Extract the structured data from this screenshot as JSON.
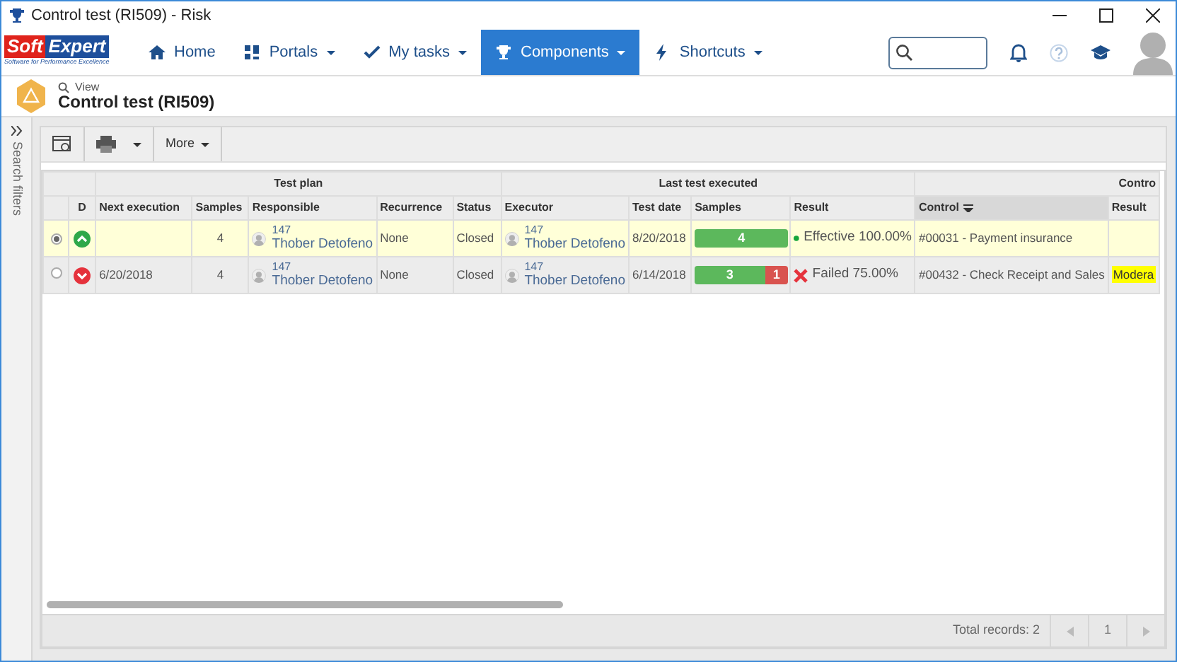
{
  "window": {
    "title": "Control test (RI509) - Risk"
  },
  "navbar": {
    "logo": {
      "word_1": "Soft",
      "word_2": "Expert",
      "tagline": "Software for Performance Excellence"
    },
    "items": [
      {
        "label": "Home",
        "kind": "home",
        "dropdown": false,
        "selected": false
      },
      {
        "label": "Portals",
        "kind": "portals",
        "dropdown": true,
        "selected": false
      },
      {
        "label": "My tasks",
        "kind": "tasks",
        "dropdown": true,
        "selected": false
      },
      {
        "label": "Components",
        "kind": "components",
        "dropdown": true,
        "selected": true
      },
      {
        "label": "Shortcuts",
        "kind": "shortcuts",
        "dropdown": true,
        "selected": false
      }
    ]
  },
  "header": {
    "mode": "View",
    "title": "Control test (RI509)"
  },
  "sidebar": {
    "label": "Search filters"
  },
  "toolbar": {
    "more": "More"
  },
  "table": {
    "groups": [
      {
        "columns": [
          {},
          {
            "label": "D"
          }
        ]
      },
      {
        "label": "Test plan",
        "columns": [
          {
            "label": "Next execution"
          },
          {
            "label": "Samples"
          },
          {
            "label": "Responsible"
          },
          {
            "label": "Recurrence"
          },
          {
            "label": "Status"
          }
        ]
      },
      {
        "label": "Last test executed",
        "columns": [
          {
            "label": "Executor"
          },
          {
            "label": "Test date"
          },
          {
            "label": "Samples"
          },
          {
            "label": "Result"
          }
        ]
      },
      {
        "label": "Contro",
        "columns": [
          {
            "label": "Control",
            "sorted": true
          },
          {
            "label": "Result",
            "sorted": false
          }
        ]
      }
    ],
    "rows": [
      {
        "selected": true,
        "kind": "up",
        "next_execution": "",
        "samples": "4",
        "responsible": {
          "code": "147",
          "name": "Thober Detofeno"
        },
        "recurrence": "None",
        "status": "Closed",
        "executor": {
          "code": "147",
          "name": "Thober Detofeno"
        },
        "test_date": "8/20/2018",
        "sample_bar": [
          {
            "kind": "pass",
            "label": "4",
            "level": 1
          }
        ],
        "result": {
          "kind": "effective",
          "text": "Effective 100.00%"
        },
        "control": "#00031 - Payment insurance"
      },
      {
        "selected": false,
        "kind": "down",
        "next_execution": "6/20/2018",
        "samples": "4",
        "responsible": {
          "code": "147",
          "name": "Thober Detofeno"
        },
        "recurrence": "None",
        "status": "Closed",
        "executor": {
          "code": "147",
          "name": "Thober Detofeno"
        },
        "test_date": "6/14/2018",
        "sample_bar": [
          {
            "kind": "pass",
            "label": "3",
            "level": 0.75
          },
          {
            "kind": "fail",
            "label": "1",
            "level": 0.25
          }
        ],
        "result": {
          "kind": "failed",
          "text": "Failed 75.00%"
        },
        "control": "#00432 - Check Receipt and Sales",
        "control_result": {
          "text": "Modera",
          "highlighted": true
        }
      }
    ]
  },
  "footer": {
    "total": "Total records: 2",
    "page": "1"
  }
}
